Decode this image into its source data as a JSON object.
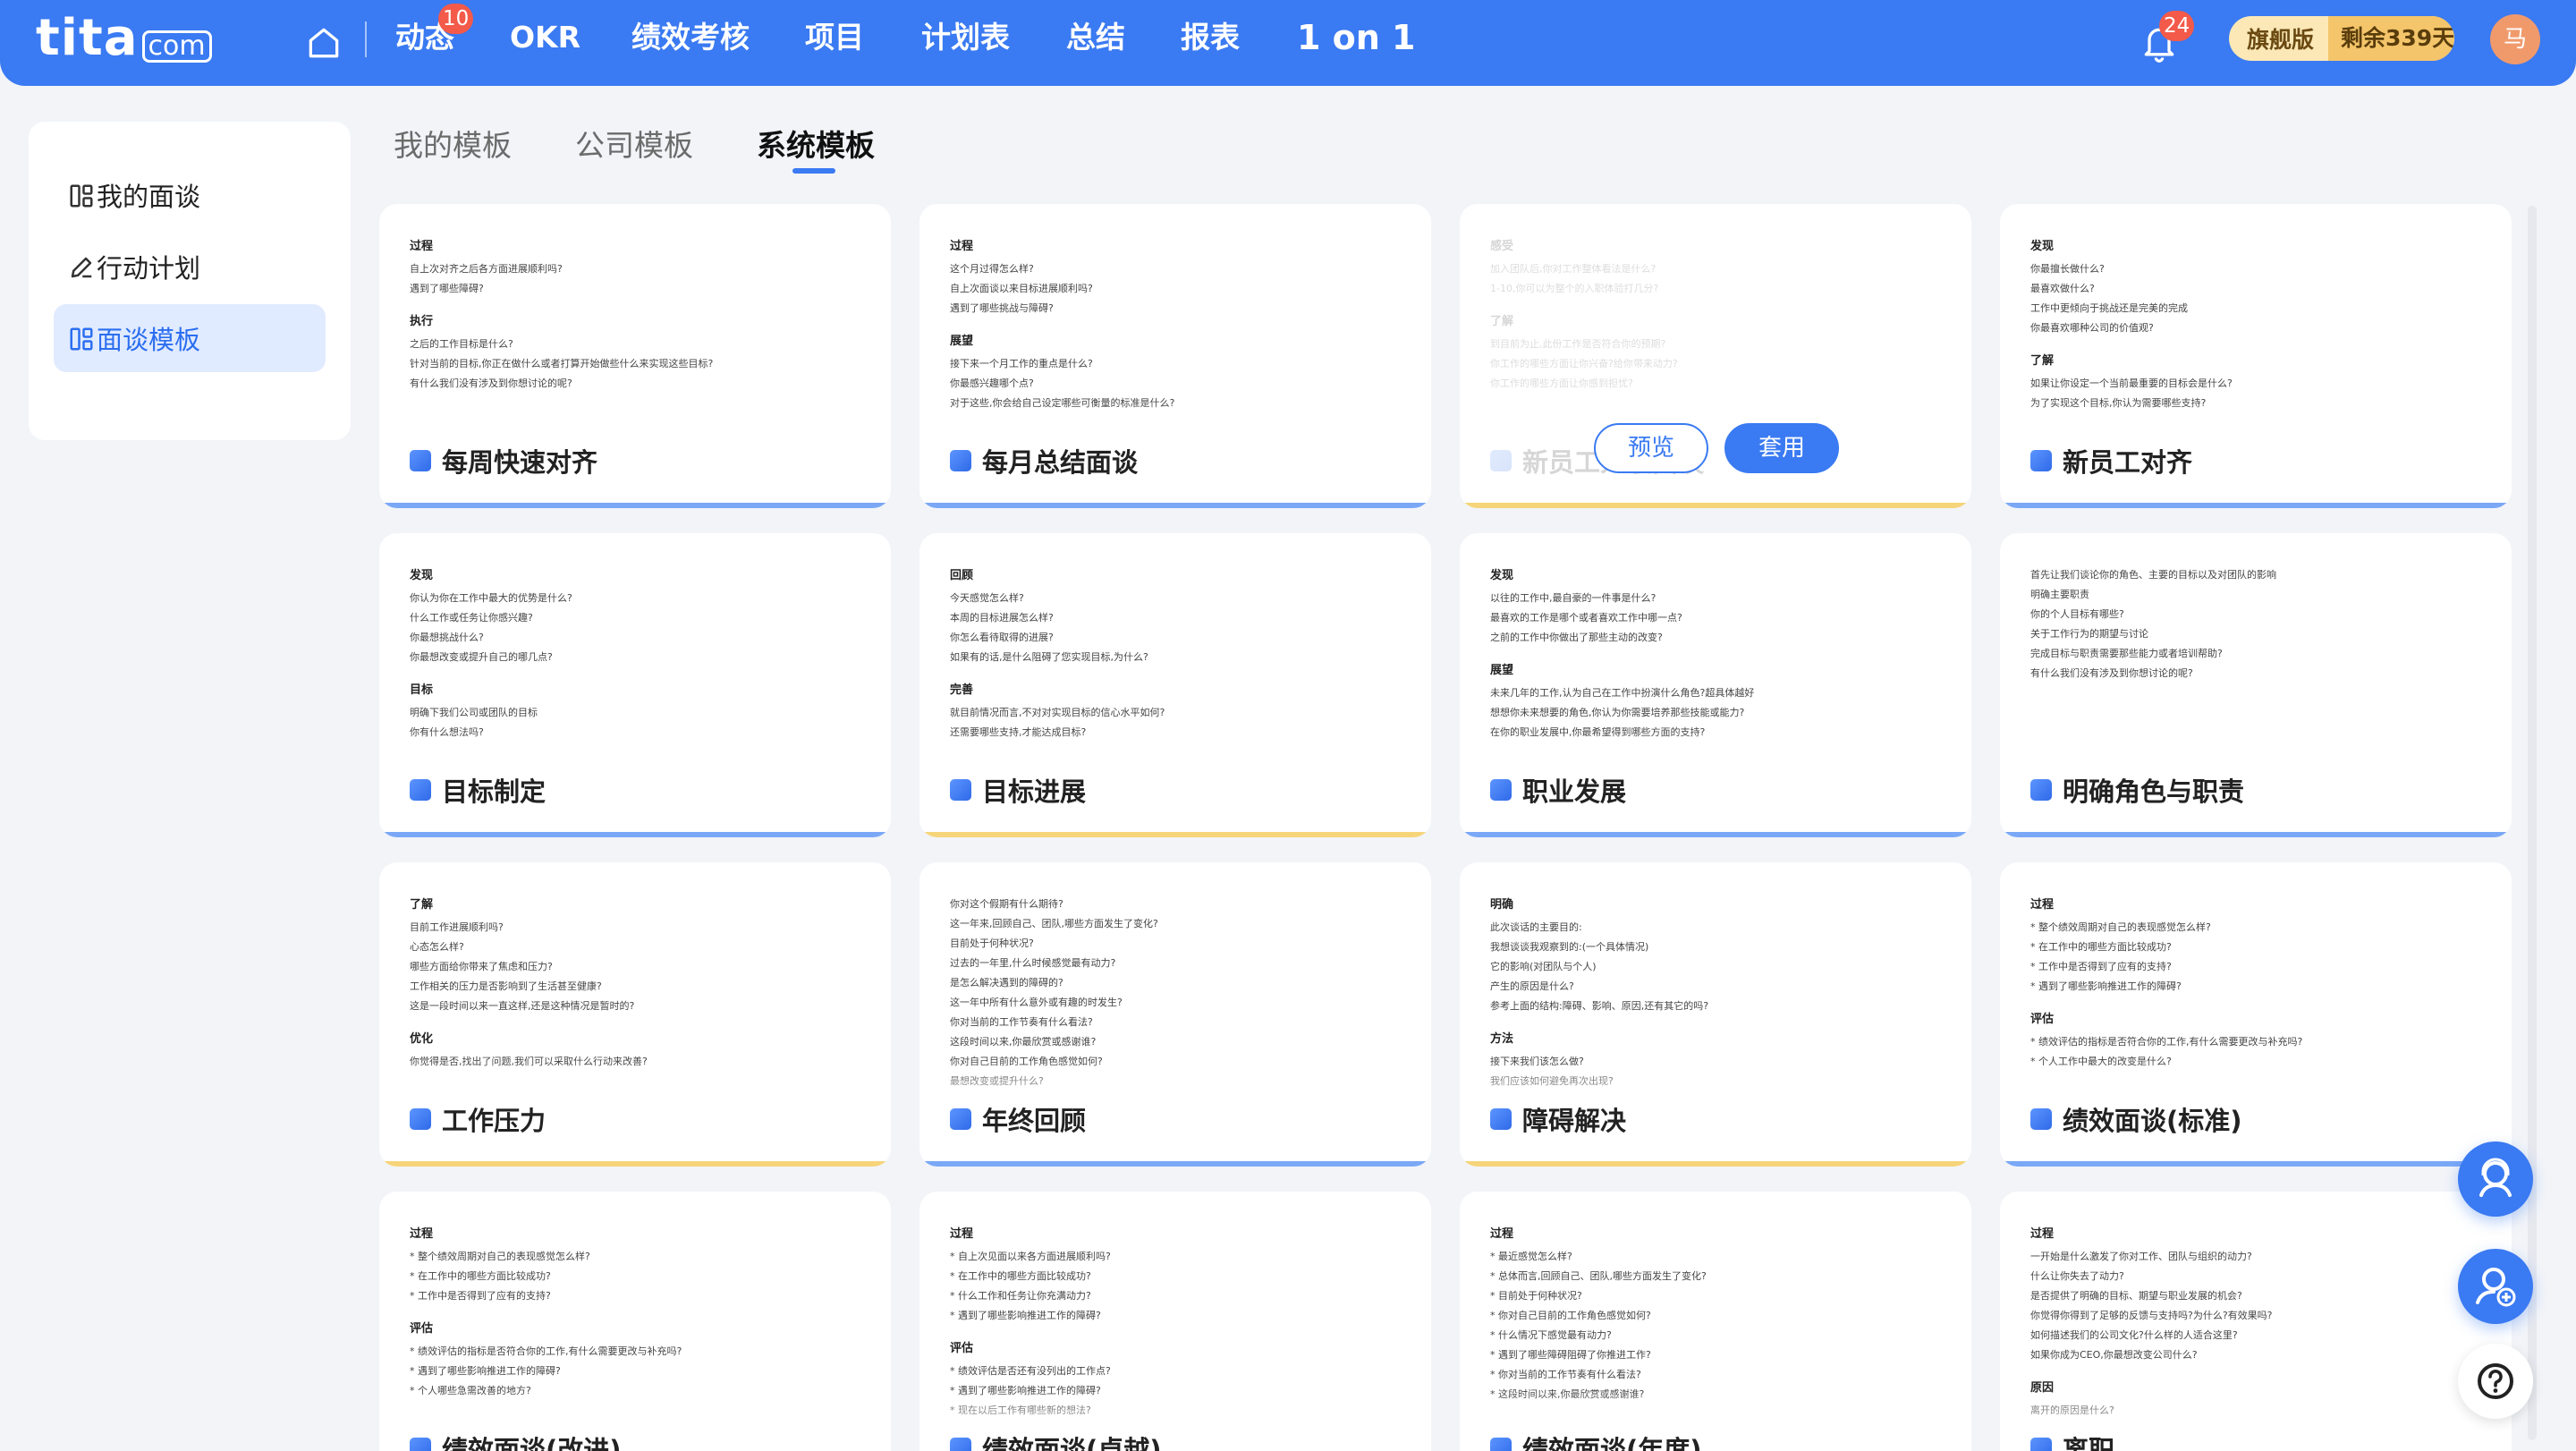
{
  "header": {
    "logo": {
      "name": "tita",
      "suffix": "com"
    },
    "nav": [
      "动态",
      "OKR",
      "绩效考核",
      "项目",
      "计划表",
      "总结",
      "报表",
      "1 on 1"
    ],
    "nav_badge": "10",
    "bell_badge": "24",
    "edition": "旗舰版",
    "remaining": "剩余339天",
    "avatar": "马"
  },
  "sidebar": {
    "items": [
      "我的面谈",
      "行动计划",
      "面谈模板"
    ],
    "active": 2
  },
  "tabs": [
    "我的模板",
    "公司模板",
    "系统模板"
  ],
  "active_tab": 2,
  "hover_buttons": {
    "preview": "预览",
    "apply": "套用"
  },
  "cards": [
    {
      "title": "每周快速对齐",
      "sections": [
        {
          "h": "过程",
          "lines": [
            "自上次对齐之后各方面进展顺利吗?",
            "遇到了哪些障碍?"
          ]
        },
        {
          "h": "执行",
          "lines": [
            "之后的工作目标是什么?",
            "针对当前的目标,你正在做什么或者打算开始做些什么来实现这些目标?",
            "有什么我们没有涉及到你想讨论的呢?"
          ]
        }
      ]
    },
    {
      "title": "每月总结面谈",
      "sections": [
        {
          "h": "过程",
          "lines": [
            "这个月过得怎么样?",
            "自上次面谈以来目标进展顺利吗?",
            "遇到了哪些挑战与障碍?"
          ]
        },
        {
          "h": "展望",
          "lines": [
            "接下来一个月工作的重点是什么?",
            "你最感兴趣哪个点?",
            "对于这些,你会给自己设定哪些可衡量的标准是什么?"
          ]
        }
      ]
    },
    {
      "title": "新员工入职面谈",
      "sections": [
        {
          "h": "感受",
          "lines": [
            "加入团队后,你对工作整体看法是什么?",
            "1-10,你可以为整个的入职体验打几分?"
          ]
        },
        {
          "h": "了解",
          "lines": [
            "到目前为止,此份工作是否符合你的预期?",
            "你工作的哪些方面让你兴奋?给你带来动力?",
            "你工作的哪些方面让你感到担忧?"
          ]
        }
      ]
    },
    {
      "title": "新员工对齐",
      "sections": [
        {
          "h": "发现",
          "lines": [
            "你最擅长做什么?",
            "最喜欢做什么?",
            "工作中更倾向于挑战还是完美的完成",
            "你最喜欢哪种公司的价值观?"
          ]
        },
        {
          "h": "了解",
          "lines": [
            "如果让你设定一个当前最重要的目标会是什么?",
            "为了实现这个目标,你认为需要哪些支持?"
          ]
        }
      ]
    },
    {
      "title": "目标制定",
      "sections": [
        {
          "h": "发现",
          "lines": [
            "你认为你在工作中最大的优势是什么?",
            "什么工作或任务让你感兴趣?",
            "你最想挑战什么?",
            "你最想改变或提升自己的哪几点?"
          ]
        },
        {
          "h": "目标",
          "lines": [
            "明确下我们公司或团队的目标",
            "你有什么想法吗?"
          ]
        }
      ]
    },
    {
      "title": "目标进展",
      "sections": [
        {
          "h": "回顾",
          "lines": [
            "今天感觉怎么样?",
            "本周的目标进展怎么样?",
            "你怎么看待取得的进展?",
            "如果有的话,是什么阻碍了您实现目标,为什么?"
          ]
        },
        {
          "h": "完善",
          "lines": [
            "就目前情况而言,不对对实现目标的信心水平如何?",
            "还需要哪些支持,才能达成目标?"
          ]
        }
      ]
    },
    {
      "title": "职业发展",
      "sections": [
        {
          "h": "发现",
          "lines": [
            "以往的工作中,最自豪的一件事是什么?",
            "最喜欢的工作是哪个或者喜欢工作中哪一点?",
            "之前的工作中你做出了那些主动的改变?"
          ]
        },
        {
          "h": "展望",
          "lines": [
            "未来几年的工作,认为自己在工作中扮演什么角色?超具体越好",
            "想想你未来想要的角色,你认为你需要培养那些技能或能力?",
            "在你的职业发展中,你最希望得到哪些方面的支持?"
          ]
        }
      ]
    },
    {
      "title": "明确角色与职责",
      "sections": [
        {
          "h": "",
          "lines": [
            "首先让我们谈论你的角色、主要的目标以及对团队的影响",
            "明确主要职责",
            "你的个人目标有哪些?",
            "关于工作行为的期望与讨论",
            "完成目标与职责需要那些能力或者培训帮助?",
            "有什么我们没有涉及到你想讨论的呢?"
          ]
        }
      ]
    },
    {
      "title": "工作压力",
      "sections": [
        {
          "h": "了解",
          "lines": [
            "目前工作进展顺利吗?",
            "心态怎么样?",
            "哪些方面给你带来了焦虑和压力?",
            "工作相关的压力是否影响到了生活甚至健康?",
            "这是一段时间以来一直这样,还是这种情况是暂时的?"
          ]
        },
        {
          "h": "优化",
          "lines": [
            "你觉得是否,找出了问题,我们可以采取什么行动来改善?"
          ]
        }
      ]
    },
    {
      "title": "年终回顾",
      "sections": [
        {
          "h": "",
          "lines": [
            "你对这个假期有什么期待?",
            "这一年来,回顾自己、团队,哪些方面发生了变化?",
            "目前处于何种状况?",
            "过去的一年里,什么时候感觉最有动力?",
            "是怎么解决遇到的障碍的?",
            "这一年中所有什么意外或有趣的时发生?",
            "你对当前的工作节奏有什么看法?",
            "这段时间以来,你最欣赏或感谢谁?",
            "你对自己目前的工作角色感觉如何?",
            "最想改变或提升什么?"
          ]
        }
      ]
    },
    {
      "title": "障碍解决",
      "sections": [
        {
          "h": "明确",
          "lines": [
            "此次谈话的主要目的:",
            "我想谈谈我观察到的:(一个具体情况)",
            "它的影响(对团队与个人)",
            "产生的原因是什么?",
            "参考上面的结构:障碍、影响、原因,还有其它的吗?"
          ]
        },
        {
          "h": "方法",
          "lines": [
            "接下来我们该怎么做?",
            "我们应该如何避免再次出现?"
          ]
        }
      ]
    },
    {
      "title": "绩效面谈(标准)",
      "sections": [
        {
          "h": "过程",
          "lines": [
            "* 整个绩效周期对自己的表现感觉怎么样?",
            "* 在工作中的哪些方面比较成功?",
            "* 工作中是否得到了应有的支持?",
            "* 遇到了哪些影响推进工作的障碍?"
          ]
        },
        {
          "h": "评估",
          "lines": [
            "* 绩效评估的指标是否符合你的工作,有什么需要更改与补充吗?",
            "* 个人工作中最大的改变是什么?"
          ]
        }
      ]
    },
    {
      "title": "绩效面谈(改进)",
      "sections": [
        {
          "h": "过程",
          "lines": [
            "* 整个绩效周期对自己的表现感觉怎么样?",
            "* 在工作中的哪些方面比较成功?",
            "* 工作中是否得到了应有的支持?"
          ]
        },
        {
          "h": "评估",
          "lines": [
            "* 绩效评估的指标是否符合你的工作,有什么需要更改与补充吗?",
            "* 遇到了哪些影响推进工作的障碍?",
            "* 个人哪些急需改善的地方?"
          ]
        }
      ]
    },
    {
      "title": "绩效面谈(卓越)",
      "sections": [
        {
          "h": "过程",
          "lines": [
            "* 自上次见面以来各方面进展顺利吗?",
            "* 在工作中的哪些方面比较成功?",
            "* 什么工作和任务让你充满动力?",
            "* 遇到了哪些影响推进工作的障碍?"
          ]
        },
        {
          "h": "评估",
          "lines": [
            "* 绩效评估是否还有没列出的工作点?",
            "* 遇到了哪些影响推进工作的障碍?",
            "* 现在以后工作有哪些新的想法?"
          ]
        }
      ]
    },
    {
      "title": "绩效面谈(年度)",
      "sections": [
        {
          "h": "过程",
          "lines": [
            "* 最近感觉怎么样?",
            "* 总体而言,回顾自己、团队,哪些方面发生了变化?",
            "* 目前处于何种状况?",
            "* 你对自己目前的工作角色感觉如何?",
            "* 什么情况下感觉最有动力?",
            "* 遇到了哪些障碍阻碍了你推进工作?",
            "* 你对当前的工作节奏有什么看法?",
            "* 这段时间以来,你最欣赏或感谢谁?"
          ]
        }
      ]
    },
    {
      "title": "离职",
      "sections": [
        {
          "h": "过程",
          "lines": [
            "一开始是什么激发了你对工作、团队与组织的动力?",
            "什么让你失去了动力?",
            "是否提供了明确的目标、期望与职业发展的机会?",
            "你觉得你得到了足够的反馈与支持吗?为什么?有效果吗?",
            "如何描述我们的公司文化?什么样的人适合这里?",
            "如果你成为CEO,你最想改变公司什么?"
          ]
        },
        {
          "h": "原因",
          "lines": [
            "离开的原因是什么?"
          ]
        }
      ]
    }
  ],
  "colors": {
    "primary": "#3a7af2",
    "badge": "#f35a4a",
    "bar_blue": "#7aa8f6",
    "bar_yellow": "#f6d479"
  }
}
